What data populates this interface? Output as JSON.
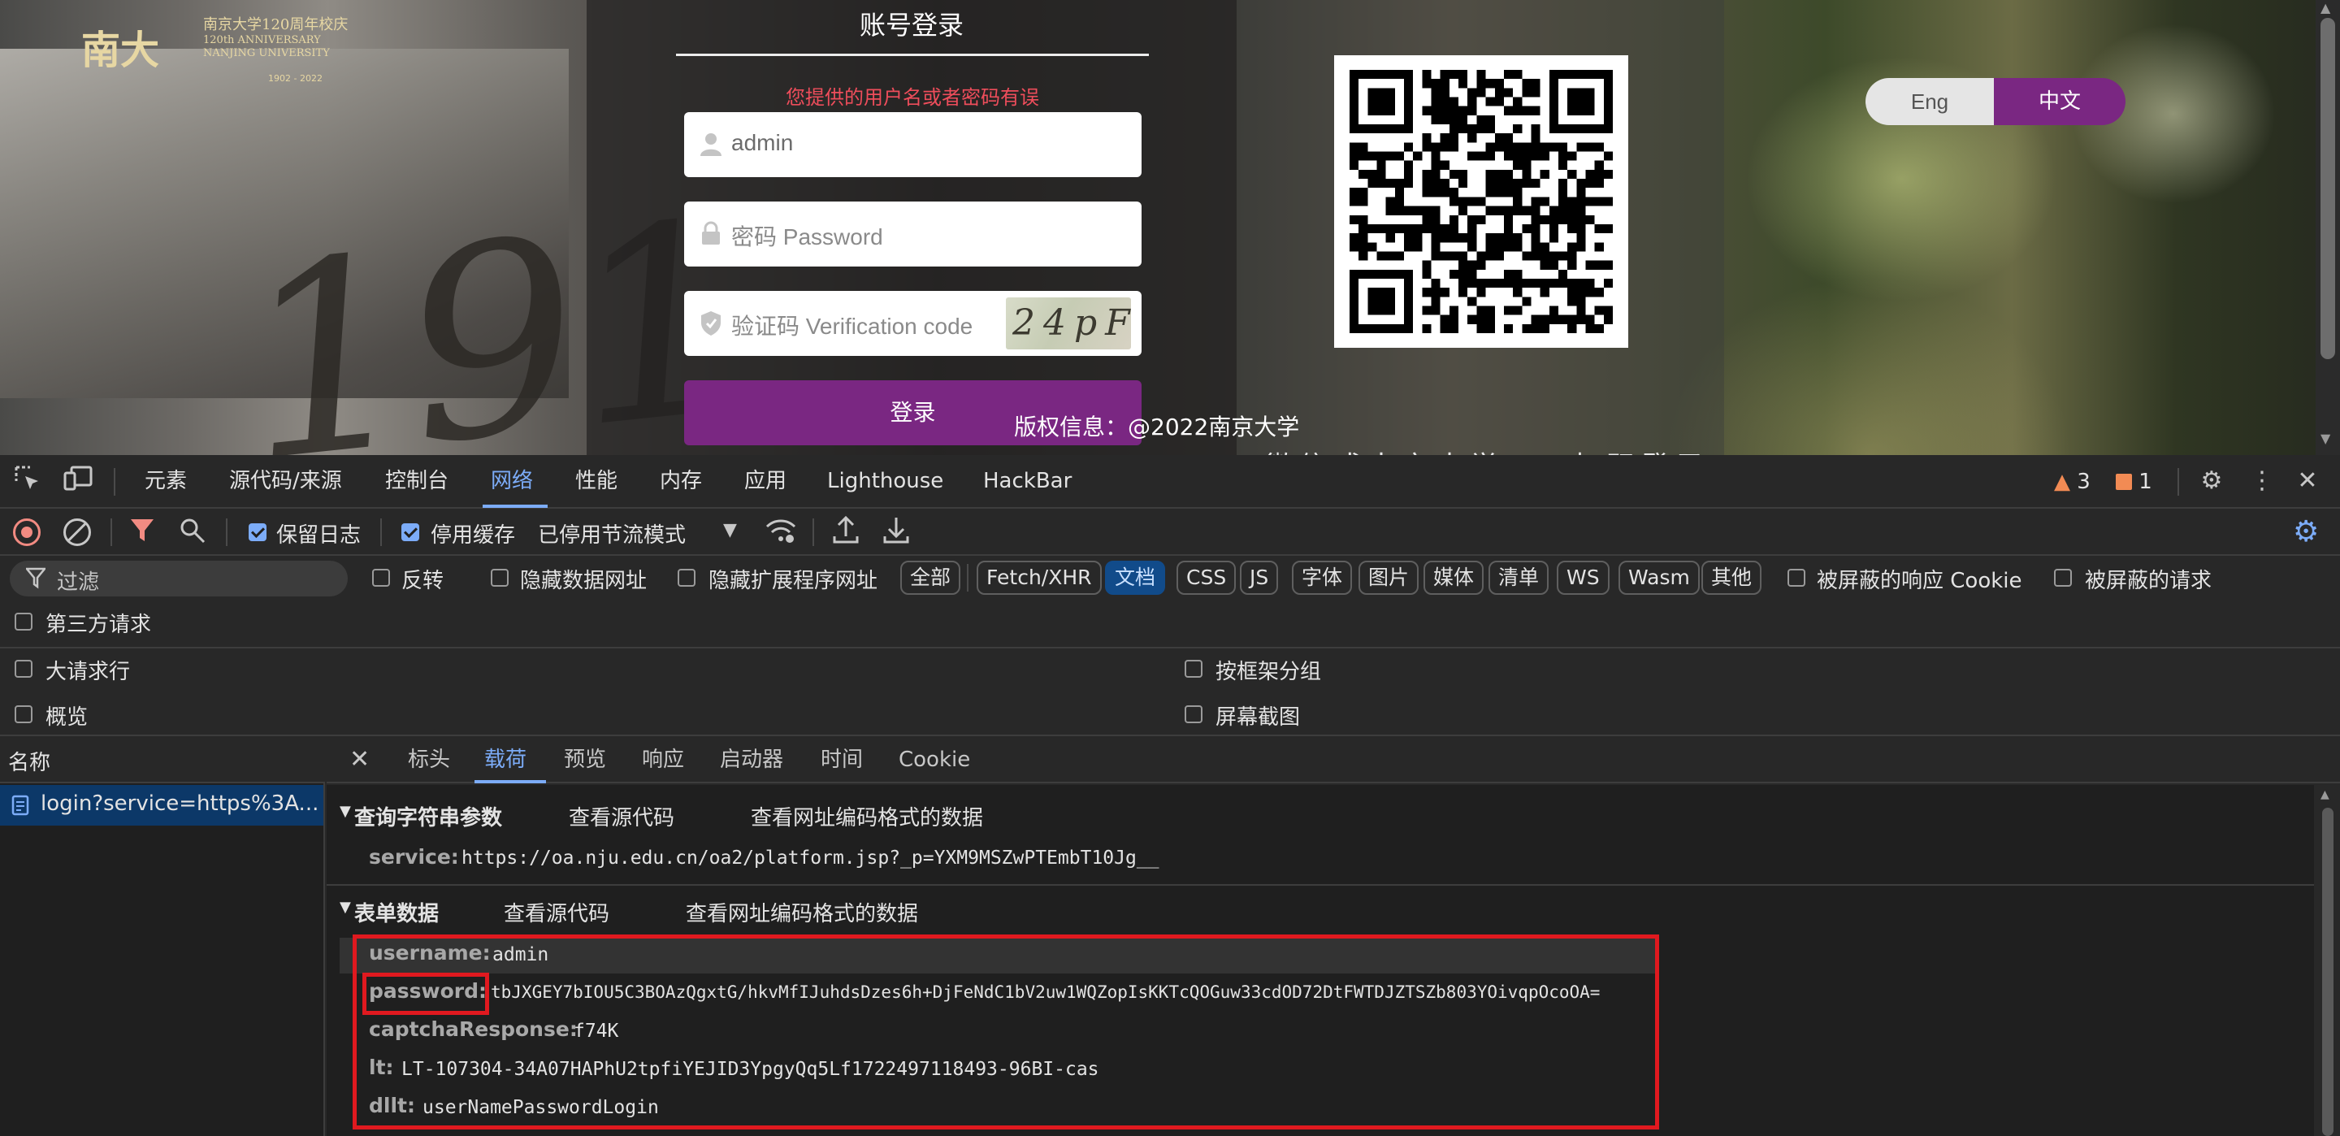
{
  "webpage": {
    "logo": {
      "mark": "南大",
      "line1": "南京大学120周年校庆",
      "line2": "120th ANNIVERSARY",
      "line3": "NANJING UNIVERSITY",
      "years": "1902 - 2022"
    },
    "background_number": "191",
    "login": {
      "title": "账号登录",
      "error": "您提供的用户名或者密码有误",
      "username_value": "admin",
      "password_placeholder": "密码 Password",
      "captcha_placeholder": "验证码 Verification code",
      "captcha_text": "24pF",
      "submit_label": "登录"
    },
    "copyright": "版权信息：@2022南京大学",
    "scrolled_text": "微信或南京大学APP扫码登录",
    "lang": {
      "eng": "Eng",
      "zh": "中文"
    }
  },
  "devtools": {
    "tabs": [
      "元素",
      "源代码/来源",
      "控制台",
      "网络",
      "性能",
      "内存",
      "应用",
      "Lighthouse",
      "HackBar"
    ],
    "active_tab": "网络",
    "warnings": "3",
    "issues": "1",
    "toolbar": {
      "preserve_log": "保留日志",
      "disable_cache": "停用缓存",
      "throttling": "已停用节流模式"
    },
    "filter": {
      "placeholder": "过滤",
      "invert": "反转",
      "hide_data_urls": "隐藏数据网址",
      "hide_ext_urls": "隐藏扩展程序网址",
      "types": [
        "全部",
        "Fetch/XHR",
        "文档",
        "CSS",
        "JS",
        "字体",
        "图片",
        "媒体",
        "清单",
        "WS",
        "Wasm",
        "其他"
      ],
      "active_type": "文档",
      "blocked_cookies": "被屏蔽的响应 Cookie",
      "blocked_requests": "被屏蔽的请求",
      "third_party": "第三方请求"
    },
    "options": {
      "big_rows": "大请求行",
      "overview": "概览",
      "group_by_frame": "按框架分组",
      "screenshots": "屏幕截图"
    },
    "request_list": {
      "header": "名称",
      "rows": [
        "login?service=https%3A..."
      ]
    },
    "detail": {
      "tabs": [
        "标头",
        "载荷",
        "预览",
        "响应",
        "启动器",
        "时间",
        "Cookie"
      ],
      "active_tab": "载荷",
      "query_section": {
        "title": "查询字符串参数",
        "view_source": "查看源代码",
        "view_encoded": "查看网址编码格式的数据",
        "params": [
          {
            "key": "service:",
            "value": "https://oa.nju.edu.cn/oa2/platform.jsp?_p=YXM9MSZwPTEmbT10Jg__"
          }
        ]
      },
      "form_section": {
        "title": "表单数据",
        "view_source": "查看源代码",
        "view_encoded": "查看网址编码格式的数据",
        "params": [
          {
            "key": "username:",
            "value": "admin"
          },
          {
            "key": "password:",
            "value": "tbJXGEY7bIOU5C3BOAzQgxtG/hkvMfIJuhdsDzes6h+DjFeNdC1bV2uw1WQZopIsKKTcQOGuw33cdOD72DtFWTDJZTSZb803YOivqpOcoOA="
          },
          {
            "key": "captchaResponse:",
            "value": "f74K"
          },
          {
            "key": "lt:",
            "value": "LT-107304-34A07HAPhU2tpfiYEJID3YpgyQq5Lf1722497118493-96BI-cas"
          },
          {
            "key": "dllt:",
            "value": "userNamePasswordLogin"
          }
        ]
      }
    }
  },
  "colors": {
    "brand_purple": "#7a2782",
    "error_red": "#ee4d5b",
    "devtools_blue": "#7cacf8",
    "highlight_red": "#e0191f"
  }
}
